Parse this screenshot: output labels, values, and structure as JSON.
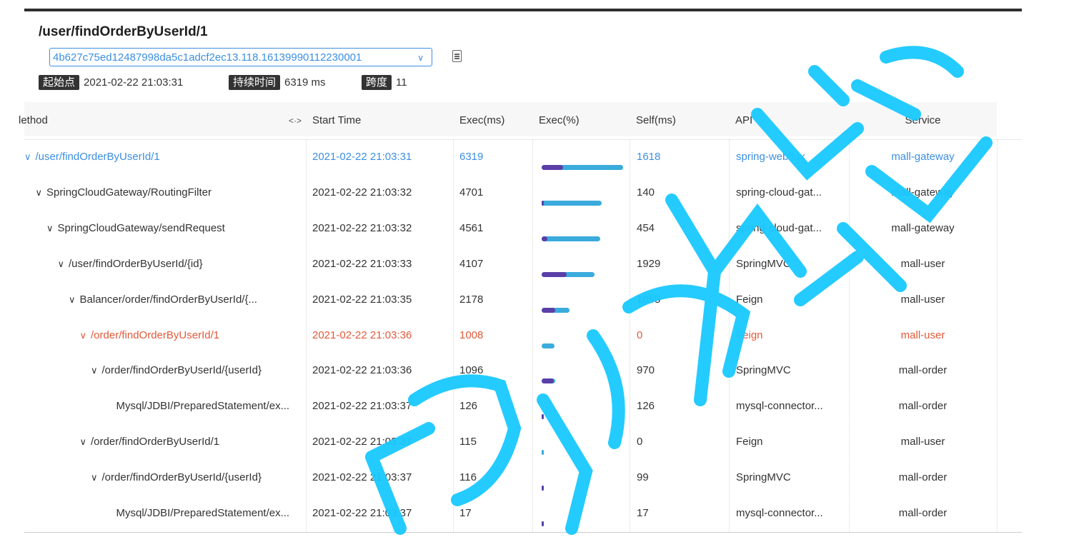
{
  "header": {
    "title": "/user/findOrderByUserId/1",
    "trace_id": "4b627c75ed12487998da5c1adcf2ec13.118.16139990112230001",
    "meta": [
      {
        "label": "起始点",
        "value": "2021-02-22 21:03:31"
      },
      {
        "label": "持续时间",
        "value": "6319 ms"
      },
      {
        "label": "跨度",
        "value": "11"
      }
    ]
  },
  "table": {
    "columns": [
      "lethod",
      "Start Time",
      "Exec(ms)",
      "Exec(%)",
      "Self(ms)",
      "API",
      "Service"
    ],
    "resize_glyph": "<·>",
    "rows": [
      {
        "method": "/user/findOrderByUserId/1",
        "indent": 0,
        "expand": true,
        "start": "2021-02-22 21:03:31",
        "exec": "6319",
        "self": "1618",
        "api": "spring-webflux",
        "service": "mall-gateway",
        "style": "blue",
        "exec_pct": 100,
        "self_pct": 26
      },
      {
        "method": "SpringCloudGateway/RoutingFilter",
        "indent": 1,
        "expand": true,
        "start": "2021-02-22 21:03:32",
        "exec": "4701",
        "self": "140",
        "api": "spring-cloud-gat...",
        "service": "mall-gateway",
        "style": "normal",
        "exec_pct": 74,
        "self_pct": 2
      },
      {
        "method": "SpringCloudGateway/sendRequest",
        "indent": 2,
        "expand": true,
        "start": "2021-02-22 21:03:32",
        "exec": "4561",
        "self": "454",
        "api": "spring-cloud-gat...",
        "service": "mall-gateway",
        "style": "normal",
        "exec_pct": 72,
        "self_pct": 7
      },
      {
        "method": "/user/findOrderByUserId/{id}",
        "indent": 3,
        "expand": true,
        "start": "2021-02-22 21:03:33",
        "exec": "4107",
        "self": "1929",
        "api": "SpringMVC",
        "service": "mall-user",
        "style": "normal",
        "exec_pct": 65,
        "self_pct": 31
      },
      {
        "method": "Balancer/order/findOrderByUserId/{...",
        "indent": 4,
        "expand": true,
        "start": "2021-02-22 21:03:35",
        "exec": "2178",
        "self": "1055",
        "api": "Feign",
        "service": "mall-user",
        "style": "normal",
        "exec_pct": 34,
        "self_pct": 17
      },
      {
        "method": "/order/findOrderByUserId/1",
        "indent": 5,
        "expand": true,
        "start": "2021-02-22 21:03:36",
        "exec": "1008",
        "self": "0",
        "api": "Feign",
        "service": "mall-user",
        "style": "red",
        "exec_pct": 16,
        "self_pct": 0
      },
      {
        "method": "/order/findOrderByUserId/{userId}",
        "indent": 6,
        "expand": true,
        "start": "2021-02-22 21:03:36",
        "exec": "1096",
        "self": "970",
        "api": "SpringMVC",
        "service": "mall-order",
        "style": "normal",
        "exec_pct": 17,
        "self_pct": 15
      },
      {
        "method": "Mysql/JDBI/PreparedStatement/ex...",
        "indent": 7,
        "expand": false,
        "start": "2021-02-22 21:03:37",
        "exec": "126",
        "self": "126",
        "api": "mysql-connector...",
        "service": "mall-order",
        "style": "normal",
        "exec_pct": 2,
        "self_pct": 2
      },
      {
        "method": "/order/findOrderByUserId/1",
        "indent": 5,
        "expand": true,
        "start": "2021-02-22 21:03:37",
        "exec": "115",
        "self": "0",
        "api": "Feign",
        "service": "mall-user",
        "style": "normal",
        "exec_pct": 2,
        "self_pct": 0
      },
      {
        "method": "/order/findOrderByUserId/{userId}",
        "indent": 6,
        "expand": true,
        "start": "2021-02-22 21:03:37",
        "exec": "116",
        "self": "99",
        "api": "SpringMVC",
        "service": "mall-order",
        "style": "normal",
        "exec_pct": 2,
        "self_pct": 2
      },
      {
        "method": "Mysql/JDBI/PreparedStatement/ex...",
        "indent": 7,
        "expand": false,
        "start": "2021-02-22 21:03:37",
        "exec": "17",
        "self": "17",
        "api": "mysql-connector...",
        "service": "mall-order",
        "style": "normal",
        "exec_pct": 1,
        "self_pct": 1
      }
    ]
  },
  "colors": {
    "link_blue": "#3d8fe0",
    "error_red": "#e05a3a",
    "bar_total": "#3aabdc",
    "bar_self": "#5a3fa8",
    "watermark": "#19c9ff"
  },
  "icons": {
    "copy": "copy-icon",
    "select_arrow": "chevron-down-icon",
    "row_toggle": "chevron-down-icon"
  }
}
